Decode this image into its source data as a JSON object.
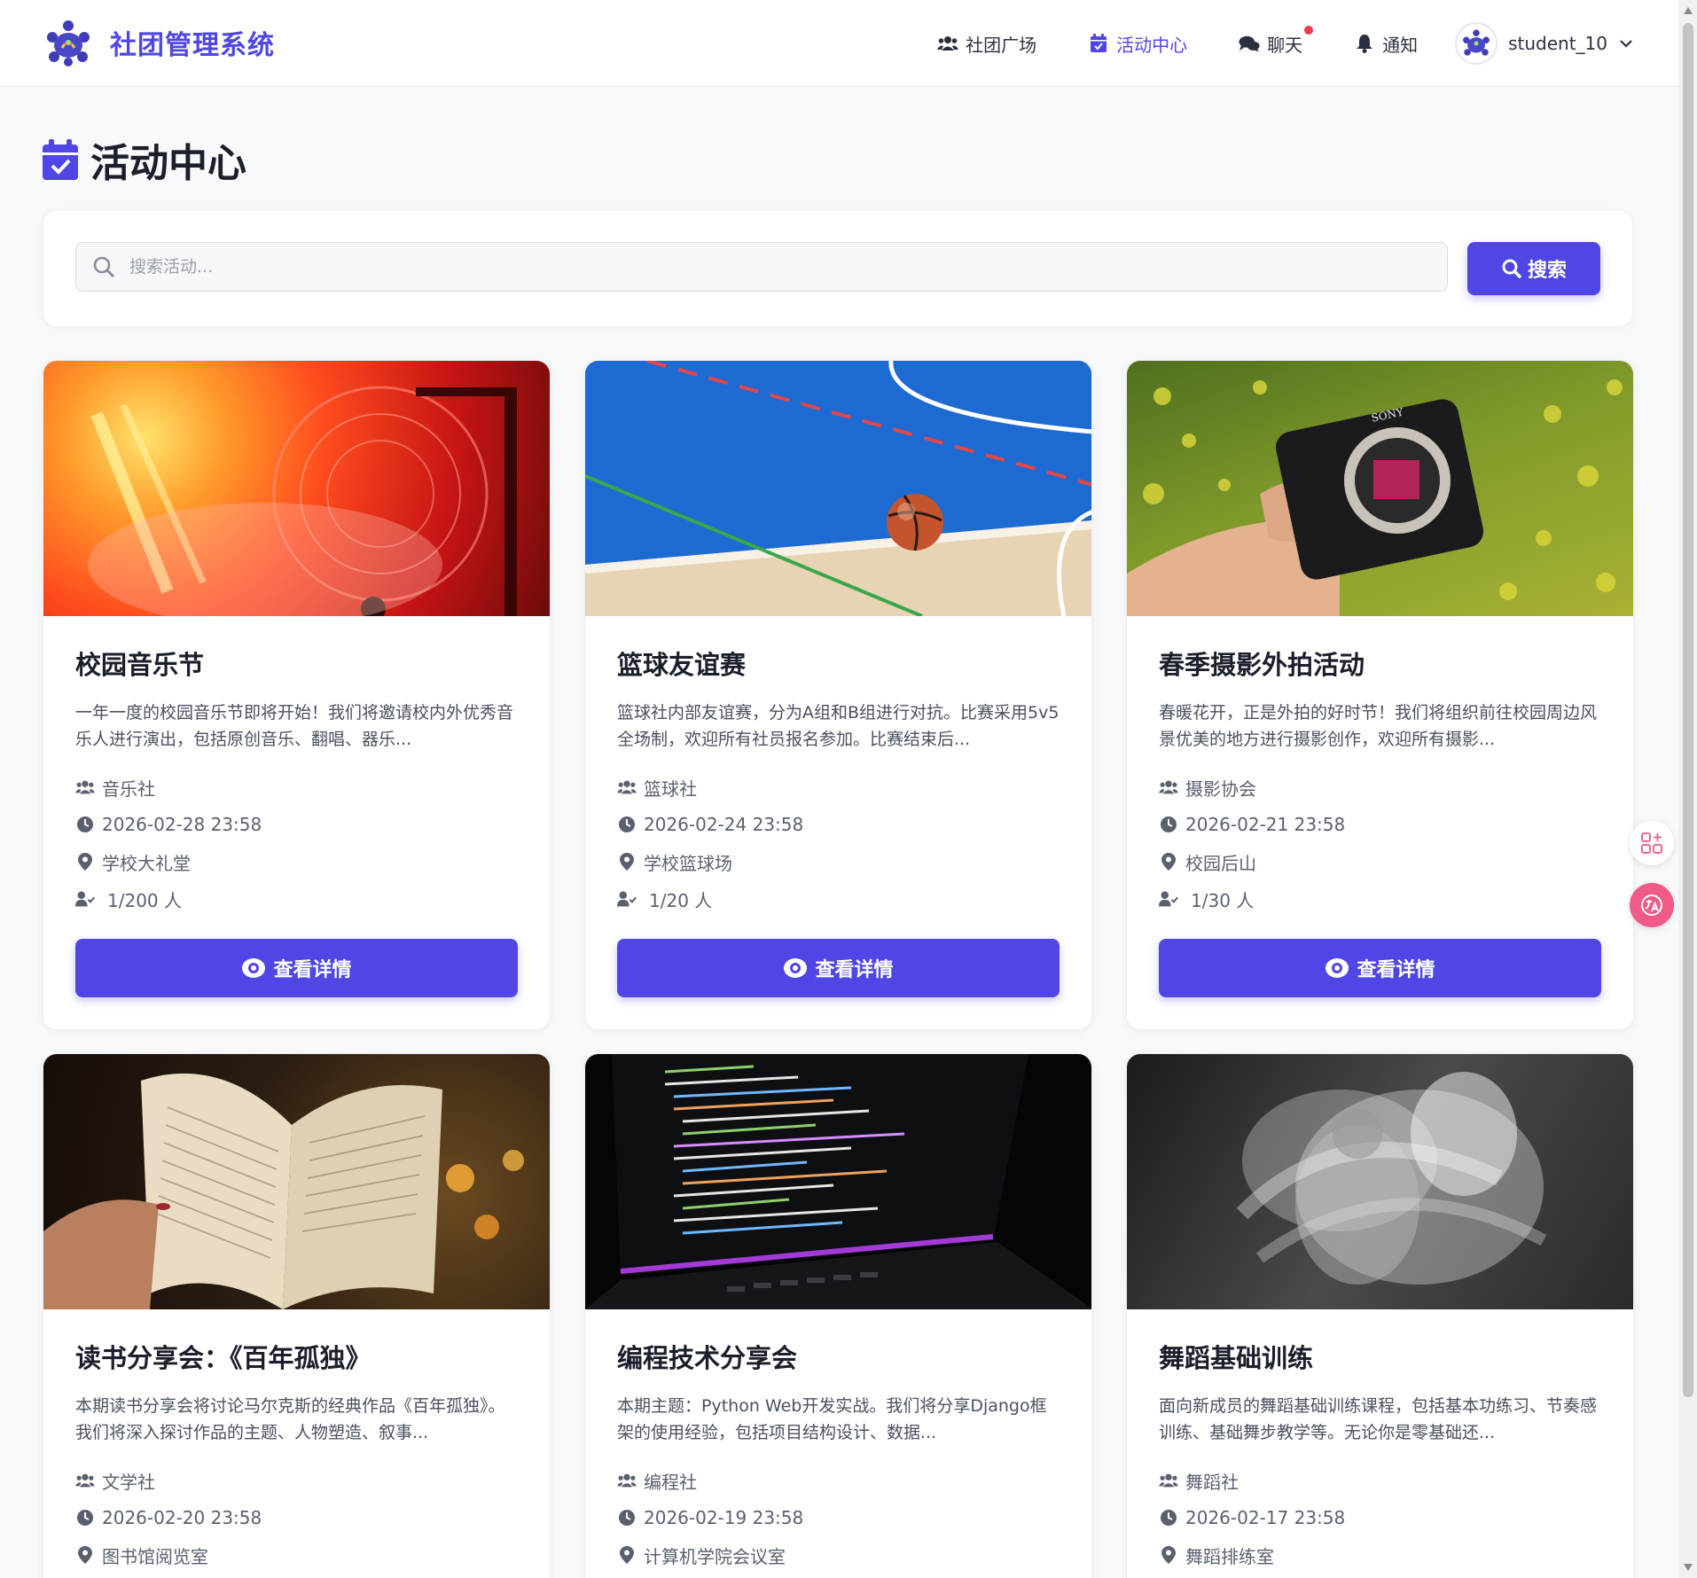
{
  "brand": {
    "name": "社团管理系统",
    "logo": "club-logo"
  },
  "nav": {
    "items": [
      {
        "label": "社团广场",
        "icon": "users-icon"
      },
      {
        "label": "活动中心",
        "icon": "calendar-check-icon",
        "active": true
      },
      {
        "label": "聊天",
        "icon": "chat-icon",
        "has_notification": true
      },
      {
        "label": "通知",
        "icon": "bell-icon"
      }
    ],
    "user": {
      "name": "student_10"
    }
  },
  "page": {
    "title": "活动中心"
  },
  "search": {
    "placeholder": "搜索活动...",
    "button_label": "搜索"
  },
  "activities": [
    {
      "title": "校园音乐节",
      "description": "一年一度的校园音乐节即将开始！我们将邀请校内外优秀音乐人进行演出，包括原创音乐、翻唱、器乐...",
      "club": "音乐社",
      "time": "2026-02-28 23:58",
      "location": "学校大礼堂",
      "participants": "1/200 人",
      "button": "查看详情",
      "image": "concert-stage"
    },
    {
      "title": "篮球友谊赛",
      "description": "篮球社内部友谊赛，分为A组和B组进行对抗。比赛采用5v5全场制，欢迎所有社员报名参加。比赛结束后...",
      "club": "篮球社",
      "time": "2026-02-24 23:58",
      "location": "学校篮球场",
      "participants": "1/20 人",
      "button": "查看详情",
      "image": "basketball-court"
    },
    {
      "title": "春季摄影外拍活动",
      "description": "春暖花开，正是外拍的好时节！我们将组织前往校园周边风景优美的地方进行摄影创作，欢迎所有摄影...",
      "club": "摄影协会",
      "time": "2026-02-21 23:58",
      "location": "校园后山",
      "participants": "1/30 人",
      "button": "查看详情",
      "image": "camera-in-hand"
    },
    {
      "title": "读书分享会：《百年孤独》",
      "description": "本期读书分享会将讨论马尔克斯的经典作品《百年孤独》。我们将深入探讨作品的主题、人物塑造、叙事...",
      "club": "文学社",
      "time": "2026-02-20 23:58",
      "location": "图书馆阅览室",
      "participants": "",
      "button": "",
      "image": "open-book"
    },
    {
      "title": "编程技术分享会",
      "description": "本期主题：Python Web开发实战。我们将分享Django框架的使用经验，包括项目结构设计、数据...",
      "club": "编程社",
      "time": "2026-02-19 23:58",
      "location": "计算机学院会议室",
      "participants": "",
      "button": "",
      "image": "code-laptop"
    },
    {
      "title": "舞蹈基础训练",
      "description": "面向新成员的舞蹈基础训练课程，包括基本功练习、节奏感训练、基础舞步教学等。无论你是零基础还...",
      "club": "舞蹈社",
      "time": "2026-02-17 23:58",
      "location": "舞蹈排练室",
      "participants": "",
      "button": "",
      "image": "dancers-motion"
    }
  ],
  "colors": {
    "primary": "#4f46e5",
    "notification": "#ef3b4d",
    "page_bg": "#f8f9fb"
  }
}
